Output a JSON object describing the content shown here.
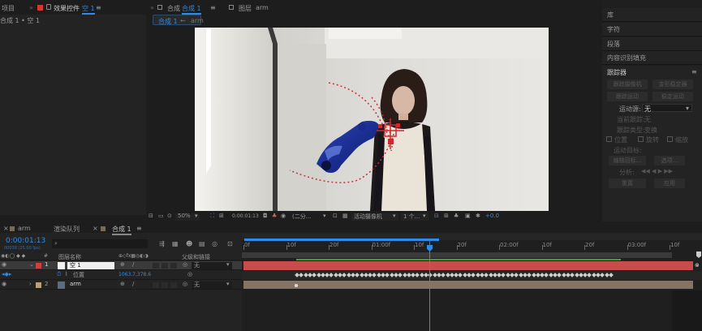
{
  "project_panel": {
    "tab_project": "项目",
    "tab_effects": "效果控件",
    "effects_target": "空 1",
    "breadcrumb": "合成 1 • 空 1"
  },
  "viewer": {
    "tab_comp_prefix": "合成",
    "tab_comp_name": "合成 1",
    "tab_layer_prefix": "图层",
    "tab_layer_name": "arm",
    "flow_comp": "合成 1",
    "flow_layer": "arm",
    "zoom": "50%",
    "timecode": "0:00:01:13",
    "resolution": "(二分...",
    "camera": "活动摄像机",
    "views": "1 个...",
    "exposure": "+0.0"
  },
  "right_panel": {
    "items": [
      "库",
      "字符",
      "段落",
      "内容识别填充"
    ],
    "tracker_title": "跟踪器",
    "buttons_row1": [
      "跟踪摄像机",
      "变形稳定器"
    ],
    "buttons_row2": [
      "跟踪运动",
      "稳定运动"
    ],
    "motion_source_label": "运动源:",
    "motion_source_value": "无",
    "current_track_label": "当前跟踪:",
    "current_track_value": "无",
    "track_type_label": "跟踪类型:",
    "track_type_value": "变换",
    "position_label": "位置",
    "rotation_label": "旋转",
    "scale_label": "缩放",
    "motion_target_label": "运动目标:",
    "edit_target": "编辑目标...",
    "options": "选项...",
    "analyze_label": "分析:",
    "reset": "重置",
    "apply": "应用"
  },
  "timeline": {
    "tabs": [
      "arm",
      "渲染队列",
      "合成 1"
    ],
    "current_time": "0:00:01:13",
    "fps_info": "00038 (25.00 fps)",
    "search_placeholder": "",
    "col_layer_name": "图层名称",
    "col_parent": "父级和链接",
    "layers": [
      {
        "num": "1",
        "name": "空 1",
        "color": "#c9403f",
        "parent": "无",
        "selected": true
      },
      {
        "num": "2",
        "name": "arm",
        "color": "#b3a27e",
        "parent": "无",
        "selected": false
      }
    ],
    "property_name": "位置",
    "property_value": "1063.7,378.6",
    "ruler": [
      "0f",
      "10f",
      "20f",
      "01:00f",
      "10f",
      "20f",
      "02:00f",
      "10f",
      "20f",
      "03:00f",
      "10f"
    ]
  },
  "colors": {
    "accent": "#2d8ceb",
    "layer1_bar": "#c9403f",
    "layer2_bar": "#7d6e5a",
    "track_path": "#c8323a"
  }
}
